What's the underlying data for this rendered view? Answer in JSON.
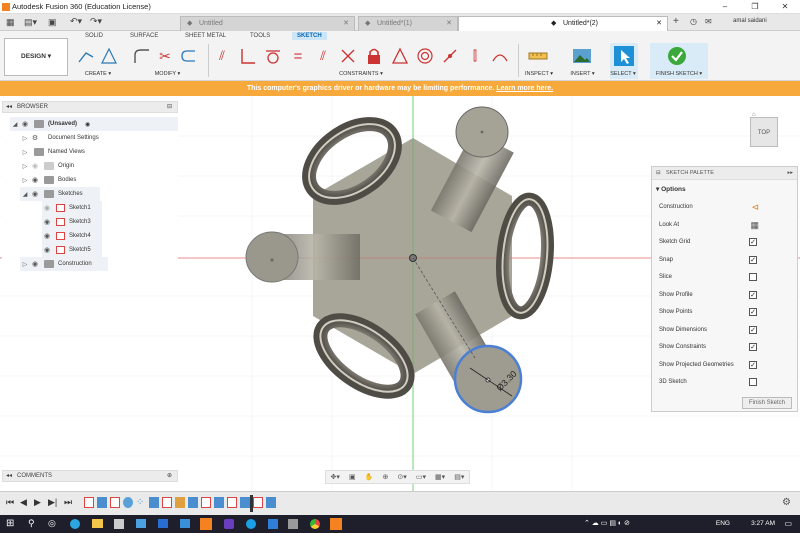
{
  "window": {
    "title": "Autodesk Fusion 360 (Education License)",
    "user": "amal saidani"
  },
  "tabs": [
    {
      "label": "Untitled",
      "active": false
    },
    {
      "label": "Untitled*(1)",
      "active": false
    },
    {
      "label": "Untitled*(2)",
      "active": true
    }
  ],
  "toolbar": {
    "mode": "DESIGN ▾",
    "env_tabs": [
      "SOLID",
      "SURFACE",
      "SHEET METAL",
      "TOOLS",
      "SKETCH"
    ],
    "groups": {
      "create": "CREATE ▾",
      "modify": "MODIFY ▾",
      "constraints": "CONSTRAINTS ▾",
      "inspect": "INSPECT ▾",
      "insert": "INSERT ▾",
      "select": "SELECT ▾",
      "finish": "FINISH SKETCH ▾"
    }
  },
  "warning": {
    "text": "This computer's graphics driver or hardware may be limiting performance.",
    "link": "Learn more here."
  },
  "browser": {
    "title": "BROWSER",
    "items": [
      {
        "label": "(Unsaved)"
      },
      {
        "label": "Document Settings"
      },
      {
        "label": "Named Views"
      },
      {
        "label": "Origin"
      },
      {
        "label": "Bodies"
      },
      {
        "label": "Sketches"
      },
      {
        "label": "Sketch1"
      },
      {
        "label": "Sketch3"
      },
      {
        "label": "Sketch4"
      },
      {
        "label": "Sketch5"
      },
      {
        "label": "Construction"
      }
    ]
  },
  "palette": {
    "title": "SKETCH PALETTE",
    "section": "Options",
    "rows": [
      {
        "label": "Construction",
        "checked": null
      },
      {
        "label": "Look At",
        "checked": null
      },
      {
        "label": "Sketch Grid",
        "checked": true
      },
      {
        "label": "Snap",
        "checked": true
      },
      {
        "label": "Slice",
        "checked": false
      },
      {
        "label": "Show Profile",
        "checked": true
      },
      {
        "label": "Show Points",
        "checked": true
      },
      {
        "label": "Show Dimensions",
        "checked": true
      },
      {
        "label": "Show Constraints",
        "checked": true
      },
      {
        "label": "Show Projected Geometries",
        "checked": true
      },
      {
        "label": "3D Sketch",
        "checked": false
      }
    ],
    "finish_button": "Finish Sketch"
  },
  "viewcube": {
    "label": "TOP"
  },
  "dimension": {
    "label": "Ø3.30"
  },
  "comments": {
    "title": "COMMENTS"
  },
  "taskbar": {
    "lang": "ENG",
    "time": "3:27 AM"
  },
  "colors": {
    "accent": "#0696d7",
    "warning": "#f7a93b",
    "sketch_tab": "#cde6f7",
    "finish_green": "#3aa83a",
    "select_blue": "#1e90d6"
  }
}
